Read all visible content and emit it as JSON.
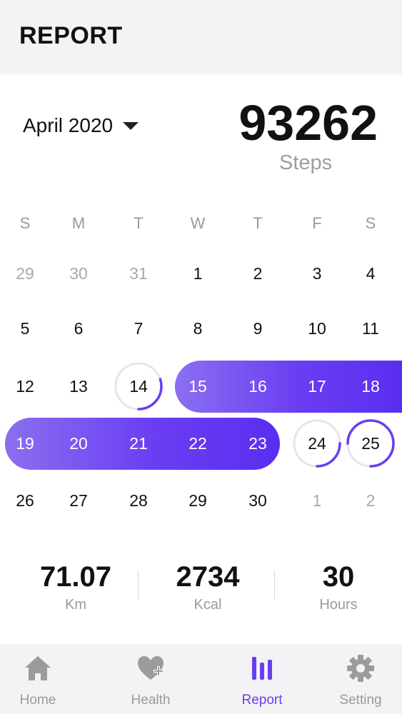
{
  "header": {
    "title": "REPORT"
  },
  "summary": {
    "month": "April 2020",
    "steps": "93262",
    "steps_unit": "Steps"
  },
  "calendar": {
    "weekdays": [
      "S",
      "M",
      "T",
      "W",
      "T",
      "F",
      "S"
    ],
    "weeks": [
      [
        {
          "d": "29",
          "m": true
        },
        {
          "d": "30",
          "m": true
        },
        {
          "d": "31",
          "m": true
        },
        {
          "d": "1"
        },
        {
          "d": "2"
        },
        {
          "d": "3"
        },
        {
          "d": "4"
        }
      ],
      [
        {
          "d": "5"
        },
        {
          "d": "6"
        },
        {
          "d": "7"
        },
        {
          "d": "8"
        },
        {
          "d": "9"
        },
        {
          "d": "10"
        },
        {
          "d": "11"
        }
      ],
      [
        {
          "d": "12"
        },
        {
          "d": "13"
        },
        {
          "d": "14",
          "goal": 0.3
        },
        {
          "d": "15",
          "r": true
        },
        {
          "d": "16",
          "r": true
        },
        {
          "d": "17",
          "r": true
        },
        {
          "d": "18",
          "r": true
        }
      ],
      [
        {
          "d": "19",
          "r": true
        },
        {
          "d": "20",
          "r": true
        },
        {
          "d": "21",
          "r": true
        },
        {
          "d": "22",
          "r": true
        },
        {
          "d": "23",
          "r": true
        },
        {
          "d": "24",
          "goal": 0.25
        },
        {
          "d": "25",
          "goal": 0.75
        }
      ],
      [
        {
          "d": "26"
        },
        {
          "d": "27"
        },
        {
          "d": "28"
        },
        {
          "d": "29"
        },
        {
          "d": "30"
        },
        {
          "d": "1",
          "m": true
        },
        {
          "d": "2",
          "m": true
        }
      ]
    ]
  },
  "stats": [
    {
      "value": "71.07",
      "unit": "Km"
    },
    {
      "value": "2734",
      "unit": "Kcal"
    },
    {
      "value": "30",
      "unit": "Hours"
    }
  ],
  "nav": [
    {
      "label": "Home",
      "icon": "home-icon"
    },
    {
      "label": "Health",
      "icon": "heart-plus-icon"
    },
    {
      "label": "Report",
      "icon": "bar-chart-icon",
      "active": true
    },
    {
      "label": "Setting",
      "icon": "gear-icon"
    }
  ],
  "colors": {
    "accent": "#6a3df2",
    "muted": "#9a9a9a",
    "ring_track": "#e6e6e6"
  }
}
